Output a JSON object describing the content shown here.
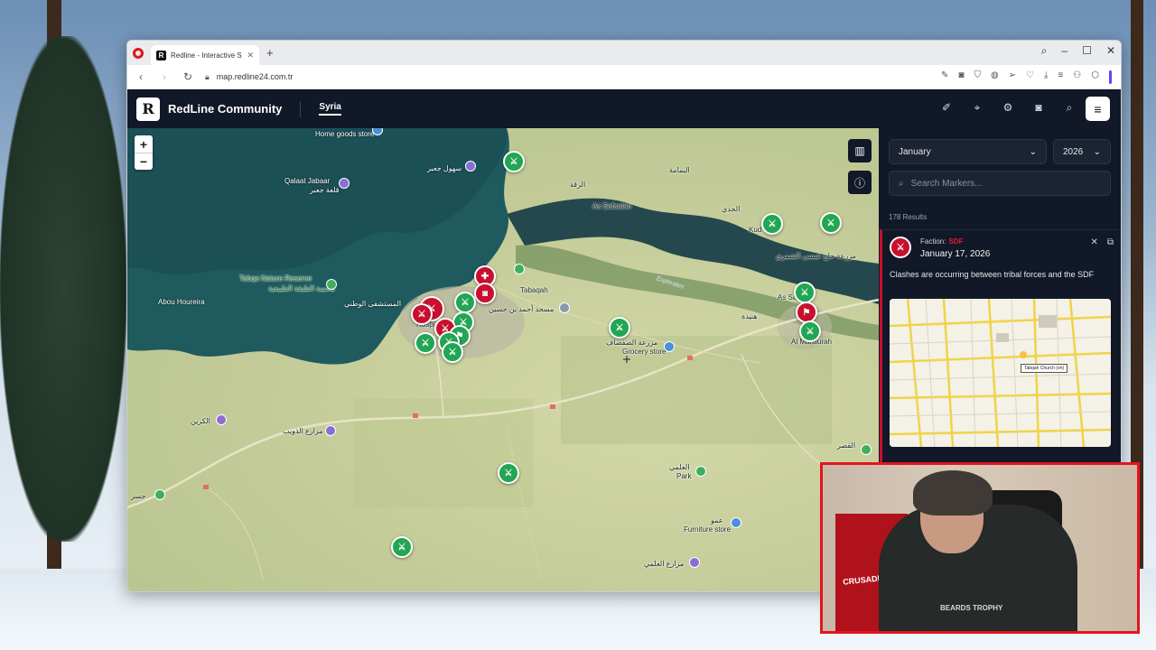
{
  "browser": {
    "tab_title": "Redline - Interactive Strat",
    "url": "map.redline24.com.tr"
  },
  "app": {
    "logo_letter": "R",
    "name": "RedLine Community",
    "nav_active": "Syria"
  },
  "panel": {
    "month": "January",
    "year": "2026",
    "search_placeholder": "Search Markers...",
    "results": "178 Results",
    "card": {
      "faction_label": "Faction:",
      "faction_value": "SDF",
      "date": "January 17, 2026",
      "description": "Clashes are occurring between tribal forces and the SDF",
      "image_tag": "Tabqah Church (en)"
    }
  },
  "map": {
    "zoom_in": "+",
    "zoom_out": "−",
    "labels": {
      "home_goods": "Home goods store",
      "qalaat_jabaar": "Qalaat Jabaar",
      "qalaat_jabaar_ar": "قلعة جعبر",
      "sohoul_jaabar": "سهول جعبر",
      "tabqa_nature": "Tabqa Nature Reserve",
      "tabqa_nature_ar": "محمية الطبقة الطبيعية",
      "abou_houreira": "Abou Houreira",
      "hospital_ar": "المستشفى الوطني",
      "hosp": "Hospi",
      "tabaqah": "Tabaqah",
      "mosque_ar": "مسجد أحمد بن حسين",
      "as_safsafah": "As Safsafah",
      "alrafqa": "الرقة",
      "yamama": "اليمامة",
      "euphrates": "Euphrates",
      "aljadhi": "الجدي",
      "kud": "Kud",
      "hajj": "مزرعة حاج عيسى الشمري",
      "as_sa": "As Sa",
      "hnaida": "هنيدة",
      "almansurah": "Al Mansurah",
      "mansurah_top": "Al",
      "grocery": "Grocery store",
      "asfa": "As",
      "safsafa_farm": "مزرعة الصفصاف",
      "alkarin": "الكرين",
      "dhuwaib": "مزارع الذويب",
      "jisr": "جسر",
      "alalami": "العلمي",
      "park": "Park",
      "furniture": "Furniture store",
      "farm_alalami": "مزارع العلمي",
      "awad": "عمو",
      "qasr": "القصر"
    }
  },
  "webcam": {
    "flag_text": "CRUSADER KINGS III",
    "shirt_text": "BEARDS TROPHY"
  }
}
